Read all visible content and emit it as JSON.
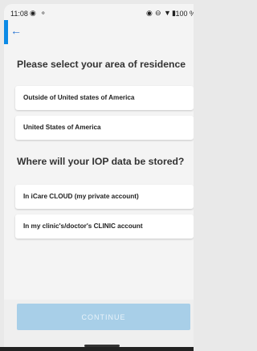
{
  "status_bar": {
    "time": "11:08",
    "battery": "100 %"
  },
  "header": {
    "back_icon": "arrow-left-icon"
  },
  "residence": {
    "title": "Please select your area of residence",
    "options": [
      "Outside of United states of America",
      "United States of America"
    ]
  },
  "storage": {
    "title": "Where will your IOP data be stored?",
    "options": [
      "In iCare CLOUD (my private account)",
      "In my clinic's/doctor's CLINIC account"
    ]
  },
  "footer": {
    "continue_label": "CONTINUE"
  },
  "colors": {
    "accent": "#0b8ae6",
    "button": "#a8cfe8"
  }
}
